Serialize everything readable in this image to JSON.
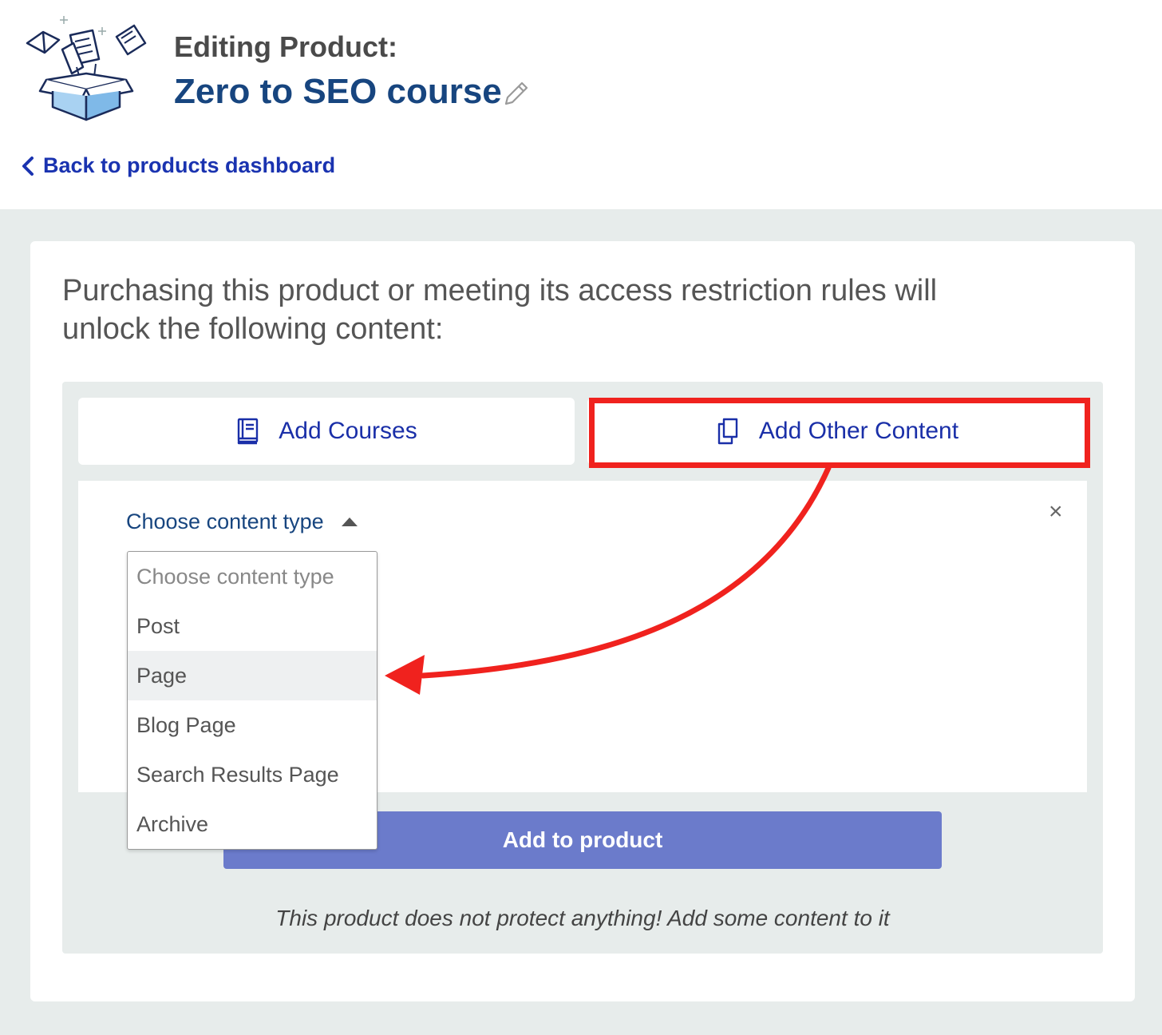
{
  "header": {
    "editing_label": "Editing Product:",
    "product_title": "Zero to SEO course",
    "back_link": "Back to products dashboard"
  },
  "main": {
    "intro_text": "Purchasing this product or meeting its access restriction rules will unlock the following content:",
    "tabs": [
      {
        "label": "Add Courses",
        "icon": "book-icon"
      },
      {
        "label": "Add Other Content",
        "icon": "documents-icon"
      }
    ],
    "select": {
      "label": "Choose content type",
      "options": [
        "Choose content type",
        "Post",
        "Page",
        "Blog Page",
        "Search Results Page",
        "Archive"
      ],
      "hovered_option": "Page"
    },
    "close_symbol": "×",
    "add_button": "Add to product",
    "empty_note": "This product does not protect anything! Add some content to it"
  },
  "colors": {
    "title": "#17457f",
    "link": "#1a33b0",
    "button": "#6b7bcb",
    "annotation": "#f0221e",
    "panel_bg": "#e7eceb"
  }
}
